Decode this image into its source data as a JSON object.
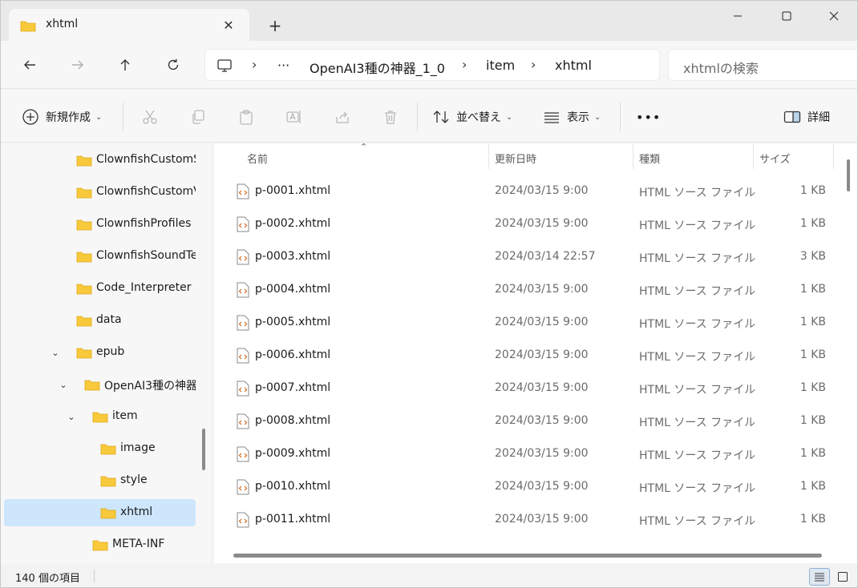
{
  "window": {
    "tab_title": "xhtml",
    "tab_close": "✕",
    "new_tab": "+"
  },
  "nav": {
    "breadcrumb": [
      "OpenAI3種の神器_1_0",
      "item",
      "xhtml"
    ],
    "ellipsis": "···",
    "search_placeholder": "xhtmlの検索"
  },
  "toolbar": {
    "new_label": "新規作成",
    "sort_label": "並べ替え",
    "view_label": "表示",
    "more_label": "•••",
    "details_label": "詳細"
  },
  "sidebar": {
    "items": [
      {
        "label": "ClownfishCustomSo",
        "indent": 0,
        "chevron": ""
      },
      {
        "label": "ClownfishCustomVo",
        "indent": 0,
        "chevron": ""
      },
      {
        "label": "ClownfishProfiles",
        "indent": 0,
        "chevron": ""
      },
      {
        "label": "ClownfishSoundTen",
        "indent": 0,
        "chevron": ""
      },
      {
        "label": "Code_Interpreter",
        "indent": 0,
        "chevron": ""
      },
      {
        "label": "data",
        "indent": 0,
        "chevron": ""
      },
      {
        "label": "epub",
        "indent": 0,
        "chevron": "⌄"
      },
      {
        "label": "OpenAI3種の神器",
        "indent": 1,
        "chevron": "⌄"
      },
      {
        "label": "item",
        "indent": 2,
        "chevron": "⌄"
      },
      {
        "label": "image",
        "indent": 3,
        "chevron": ""
      },
      {
        "label": "style",
        "indent": 3,
        "chevron": ""
      },
      {
        "label": "xhtml",
        "indent": 3,
        "chevron": "",
        "selected": true
      },
      {
        "label": "META-INF",
        "indent": 2,
        "chevron": ""
      }
    ]
  },
  "columns": {
    "name": "名前",
    "modified": "更新日時",
    "type": "種類",
    "size": "サイズ"
  },
  "files": [
    {
      "name": "p-0001.xhtml",
      "modified": "2024/03/15 9:00",
      "type": "HTML ソース ファイル",
      "size": "1 KB"
    },
    {
      "name": "p-0002.xhtml",
      "modified": "2024/03/15 9:00",
      "type": "HTML ソース ファイル",
      "size": "1 KB"
    },
    {
      "name": "p-0003.xhtml",
      "modified": "2024/03/14 22:57",
      "type": "HTML ソース ファイル",
      "size": "3 KB"
    },
    {
      "name": "p-0004.xhtml",
      "modified": "2024/03/15 9:00",
      "type": "HTML ソース ファイル",
      "size": "1 KB"
    },
    {
      "name": "p-0005.xhtml",
      "modified": "2024/03/15 9:00",
      "type": "HTML ソース ファイル",
      "size": "1 KB"
    },
    {
      "name": "p-0006.xhtml",
      "modified": "2024/03/15 9:00",
      "type": "HTML ソース ファイル",
      "size": "1 KB"
    },
    {
      "name": "p-0007.xhtml",
      "modified": "2024/03/15 9:00",
      "type": "HTML ソース ファイル",
      "size": "1 KB"
    },
    {
      "name": "p-0008.xhtml",
      "modified": "2024/03/15 9:00",
      "type": "HTML ソース ファイル",
      "size": "1 KB"
    },
    {
      "name": "p-0009.xhtml",
      "modified": "2024/03/15 9:00",
      "type": "HTML ソース ファイル",
      "size": "1 KB"
    },
    {
      "name": "p-0010.xhtml",
      "modified": "2024/03/15 9:00",
      "type": "HTML ソース ファイル",
      "size": "1 KB"
    },
    {
      "name": "p-0011.xhtml",
      "modified": "2024/03/15 9:00",
      "type": "HTML ソース ファイル",
      "size": "1 KB"
    }
  ],
  "status": {
    "item_count": "140 個の項目"
  },
  "colors": {
    "accent": "#0067c0",
    "folder": "#f8c93a",
    "selected": "#cde6fb"
  }
}
